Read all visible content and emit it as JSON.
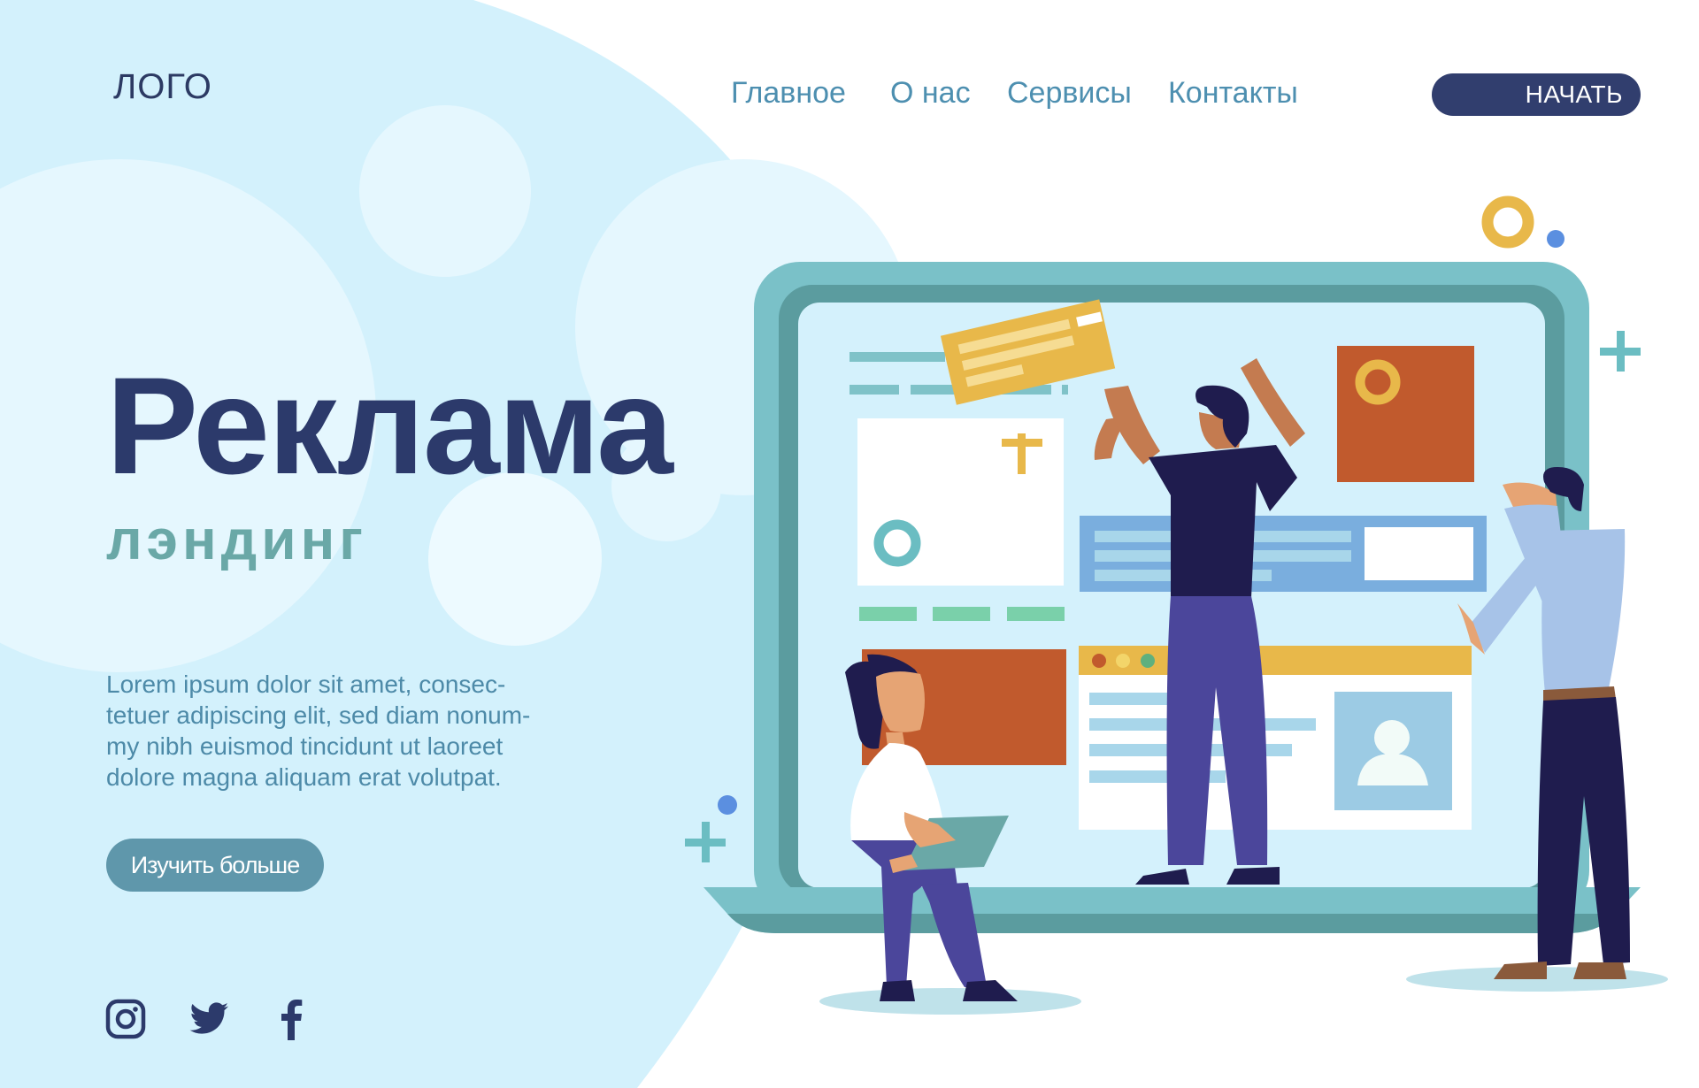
{
  "header": {
    "logo": "ЛОГО",
    "nav": [
      "Главное",
      "О нас",
      "Сервисы",
      "Контакты"
    ],
    "start_button": "НАЧАТЬ"
  },
  "hero": {
    "title": "Реклама",
    "subtitle": "лэндинг",
    "text_lines": [
      "Lorem ipsum dolor sit amet, consec-",
      "tetuer adipiscing elit, sed diam nonum-",
      "my nibh euismod tincidunt ut laoreet",
      "dolore magna aliquam erat volutpat."
    ],
    "cta_button": "Изучить больше"
  },
  "socials": [
    "instagram-icon",
    "twitter-icon",
    "facebook-icon"
  ],
  "colors": {
    "navy": "#2c3a6b",
    "teal": "#6aa8a7",
    "nav_blue": "#4d8fb0",
    "button_navy": "#313e6e",
    "button_teal": "#5f97ab",
    "light_blue_bg": "#d4f2fc"
  }
}
